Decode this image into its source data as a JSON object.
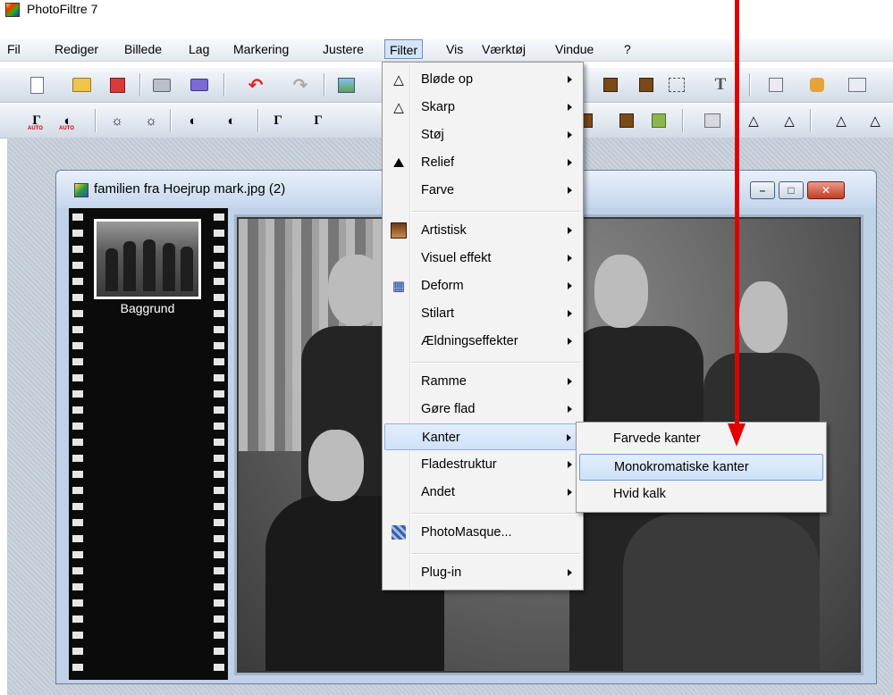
{
  "window": {
    "title": "PhotoFiltre 7"
  },
  "menubar": {
    "items": [
      "Fil",
      "Rediger",
      "Billede",
      "Lag",
      "Markering",
      "Justere",
      "Filter",
      "Vis",
      "Værktøj",
      "Vindue",
      "?"
    ],
    "active": "Filter"
  },
  "toolbar1": {
    "icons": [
      "new-icon",
      "open-icon",
      "save-icon",
      "print-icon",
      "scan-icon",
      "undo-icon",
      "redo-icon",
      "image-icon",
      "film-icon",
      "film-icon",
      "selection-icon",
      "text-icon",
      "plugin-icon",
      "puzzle-icon",
      "panel-icon"
    ]
  },
  "toolbar2": {
    "auto_label": "AUTO",
    "glyphs": {
      "gamma": "Γ",
      "contrast": "◐",
      "sun": "☼",
      "drop": "△",
      "minus": "−",
      "plus": "+"
    }
  },
  "document": {
    "title": "familien fra Hoejrup mark.jpg (2)",
    "layer_name": "Baggrund",
    "buttons": {
      "minimize": "–",
      "maximize": "□",
      "close": "✕"
    }
  },
  "filter_menu": {
    "items": [
      {
        "label": "Bløde op",
        "icon": "blur-drop-icon",
        "glyph": "△",
        "submenu": true
      },
      {
        "label": "Skarp",
        "icon": "sharpen-icon",
        "glyph": "△",
        "submenu": true
      },
      {
        "label": "Støj",
        "icon": "",
        "glyph": "",
        "submenu": true
      },
      {
        "label": "Relief",
        "icon": "relief-icon",
        "glyph": "⛰",
        "submenu": true
      },
      {
        "label": "Farve",
        "icon": "",
        "glyph": "",
        "submenu": true
      },
      {
        "label": "Artistisk",
        "icon": "artistic-icon",
        "glyph": "",
        "submenu": true
      },
      {
        "label": "Visuel effekt",
        "icon": "",
        "glyph": "",
        "submenu": true
      },
      {
        "label": "Deform",
        "icon": "deform-icon",
        "glyph": "▦",
        "submenu": true
      },
      {
        "label": "Stilart",
        "icon": "",
        "glyph": "",
        "submenu": true
      },
      {
        "label": "Ældningseffekter",
        "icon": "",
        "glyph": "",
        "submenu": true
      },
      {
        "label": "Ramme",
        "icon": "",
        "glyph": "",
        "submenu": true
      },
      {
        "label": "Gøre flad",
        "icon": "",
        "glyph": "",
        "submenu": true
      },
      {
        "label": "Kanter",
        "icon": "",
        "glyph": "",
        "submenu": true,
        "highlighted": true
      },
      {
        "label": "Fladestruktur",
        "icon": "",
        "glyph": "",
        "submenu": true
      },
      {
        "label": "Andet",
        "icon": "",
        "glyph": "",
        "submenu": true
      },
      {
        "label": "PhotoMasque...",
        "icon": "photomasque-icon",
        "glyph": "",
        "submenu": false
      },
      {
        "label": "Plug-in",
        "icon": "",
        "glyph": "",
        "submenu": true
      }
    ]
  },
  "kanter_submenu": {
    "items": [
      {
        "label": "Farvede kanter"
      },
      {
        "label": "Monokromatiske kanter",
        "highlighted": true
      },
      {
        "label": "Hvid kalk"
      }
    ]
  },
  "colors": {
    "menu_highlight": "#cfe1f7",
    "annotation_arrow": "#e00000",
    "workspace": "#c6cfda"
  }
}
